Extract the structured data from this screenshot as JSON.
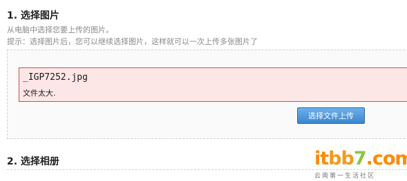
{
  "step1": {
    "title": "1. 选择图片",
    "description": "从电脑中选择您要上传的图片。",
    "hint": "提示：选择图片后，您可以继续选择图片，这样就可以一次上传多张图片了"
  },
  "error": {
    "filename": "_IGP7252.jpg",
    "message": "文件太大."
  },
  "upload_button": {
    "label": "选择文件上传"
  },
  "step2": {
    "title": "2. 选择相册"
  },
  "watermark": {
    "logo_it": "it",
    "logo_bb": "bb",
    "logo_7": "7",
    "logo_com": ".com",
    "subtitle": "云南第一生活社区"
  },
  "colors": {
    "error_background": "#fde6e6",
    "error_border": "#c75050",
    "button_top": "#6cb0ea",
    "button_bottom": "#3a86cf",
    "watermark_orange": "#ff8a00",
    "watermark_green": "#8cc63f"
  }
}
